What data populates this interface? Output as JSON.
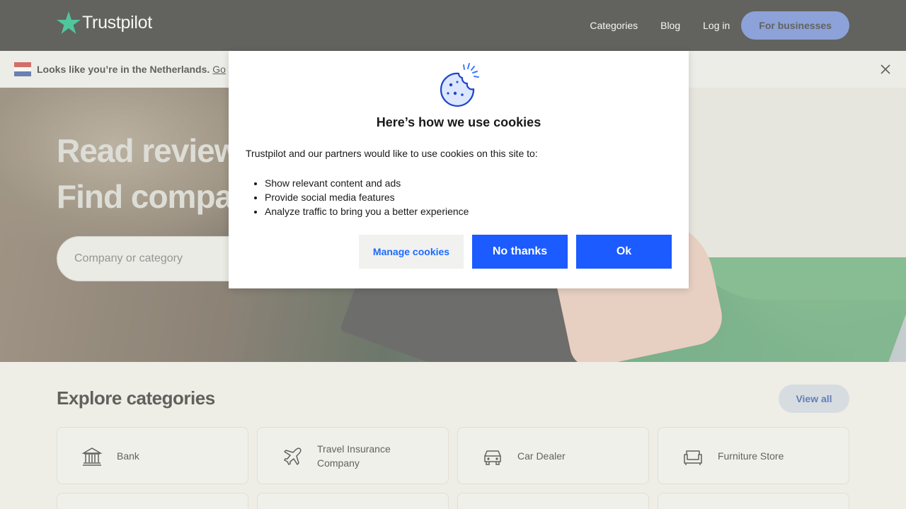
{
  "header": {
    "logo_text": "Trustpilot",
    "nav": {
      "categories": "Categories",
      "blog": "Blog",
      "login": "Log in",
      "for_businesses": "For businesses"
    }
  },
  "banner": {
    "text": "Looks like you’re in the Netherlands.",
    "link": "Go"
  },
  "hero": {
    "title_line1": "Read reviews.",
    "title_line2": "Find companies.",
    "search_placeholder": "Company or category"
  },
  "categories": {
    "title": "Explore categories",
    "view_all": "View all",
    "items": [
      {
        "label": "Bank",
        "icon": "bank-icon"
      },
      {
        "label": "Travel Insurance Company",
        "icon": "airplane-icon"
      },
      {
        "label": "Car Dealer",
        "icon": "car-icon"
      },
      {
        "label": "Furniture Store",
        "icon": "sofa-icon"
      }
    ]
  },
  "cookie_modal": {
    "title": "Here’s how we use cookies",
    "intro": "Trustpilot and our partners would like to use cookies on this site to:",
    "items": [
      "Show relevant content and ads",
      "Provide social media features",
      "Analyze traffic to bring you a better experience"
    ],
    "buttons": {
      "manage": "Manage cookies",
      "no_thanks": "No thanks",
      "ok": "Ok"
    }
  },
  "colors": {
    "brand_green": "#00b67a",
    "primary_blue": "#1b5bff",
    "header_bg": "#1c1c1c"
  }
}
